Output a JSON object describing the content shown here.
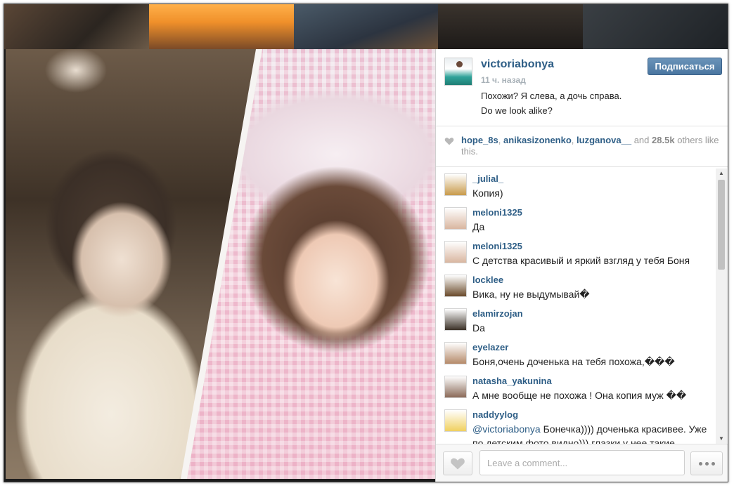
{
  "post": {
    "username": "victoriabonya",
    "time": "11 ч. назад",
    "caption_line1": "Похожи? Я слева, а дочь справа.",
    "caption_line2": "Do we look alike?",
    "follow_label": "Подписаться"
  },
  "likes": {
    "users": [
      "hope_8s",
      "anikasizonenko",
      "luzganova__"
    ],
    "and": "and",
    "count": "28.5k",
    "suffix": "others like this."
  },
  "comments": [
    {
      "user": "_julial_",
      "text": "Копия)",
      "avatar_color": "#c89a4a"
    },
    {
      "user": "meloni1325",
      "text": "Да",
      "avatar_color": "#d9b6a0"
    },
    {
      "user": "meloni1325",
      "text": "С детства красивый и яркий взгляд у тебя Боня",
      "avatar_color": "#d9b6a0"
    },
    {
      "user": "locklee",
      "text": "Вика, ну не выдумывай�",
      "avatar_color": "#6a4a2a"
    },
    {
      "user": "elamirzojan",
      "text": "Da",
      "avatar_color": "#3a3026"
    },
    {
      "user": "eyelazer",
      "text": "Боня,очень доченька на тебя похожа,���",
      "avatar_color": "#b58a6a"
    },
    {
      "user": "natasha_yakunina",
      "text": "А мне вообще не похожа ! Она копия муж ��",
      "avatar_color": "#8a6a58"
    },
    {
      "user": "naddyylog",
      "mention": "@victoriabonya",
      "text": " Бонечка)))) доченька красивее. Уже по детским фото видно))) глазки у нее такие",
      "avatar_color": "#f0d060"
    }
  ],
  "composer": {
    "placeholder": "Leave a comment..."
  },
  "icons": {
    "heart": "heart-icon",
    "more": "more-icon"
  }
}
